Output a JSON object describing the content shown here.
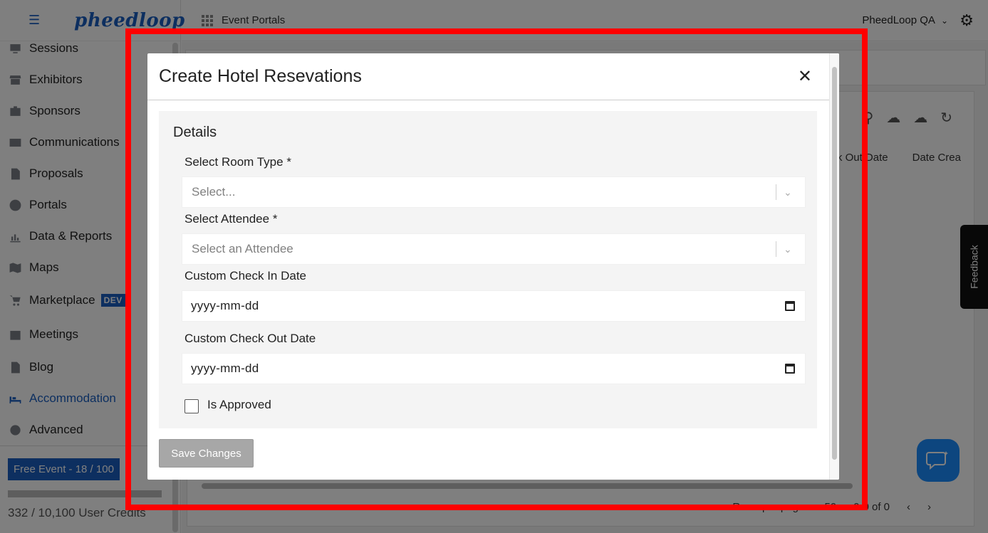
{
  "sidebar": {
    "logo": "pheedloop",
    "items": [
      {
        "label": "Sessions",
        "icon": "monitor-icon"
      },
      {
        "label": "Exhibitors",
        "icon": "storefront-icon"
      },
      {
        "label": "Sponsors",
        "icon": "badge-icon"
      },
      {
        "label": "Communications",
        "icon": "mail-icon"
      },
      {
        "label": "Proposals",
        "icon": "document-icon"
      },
      {
        "label": "Portals",
        "icon": "globe-icon"
      },
      {
        "label": "Data & Reports",
        "icon": "chart-icon"
      },
      {
        "label": "Maps",
        "icon": "map-icon"
      },
      {
        "label": "Marketplace",
        "icon": "cart-icon",
        "badge": "DEV"
      },
      {
        "label": "Meetings",
        "icon": "calendar-icon"
      },
      {
        "label": "Blog",
        "icon": "article-icon"
      },
      {
        "label": "Accommodation",
        "icon": "bed-icon",
        "active": true
      },
      {
        "label": "Advanced",
        "icon": "gear-icon"
      }
    ],
    "free_event": "Free Event - 18 / 100",
    "credits": "332 / 10,100 User Credits"
  },
  "topbar": {
    "breadcrumb": "Event Portals",
    "account": "PheedLoop QA"
  },
  "table": {
    "columns": [
      "ck Out Date",
      "Date Crea"
    ],
    "rows_per_page_label": "Rows per page:",
    "rows_per_page": "50",
    "range": "0-0 of 0"
  },
  "feedback": "Feedback",
  "modal": {
    "title": "Create Hotel Resevations",
    "section": "Details",
    "room_type": {
      "label": "Select Room Type *",
      "placeholder": "Select..."
    },
    "attendee": {
      "label": "Select Attendee *",
      "placeholder": "Select an Attendee"
    },
    "check_in": {
      "label": "Custom Check In Date",
      "value": "yyyy-mm-dd"
    },
    "check_out": {
      "label": "Custom Check Out Date",
      "value": "yyyy-mm-dd"
    },
    "approved": {
      "label": "Is Approved",
      "checked": false
    },
    "save": "Save Changes"
  },
  "colors": {
    "brand": "#1b5fc1",
    "highlight_frame": "#ff0000",
    "chat_button": "#1a8cff"
  }
}
